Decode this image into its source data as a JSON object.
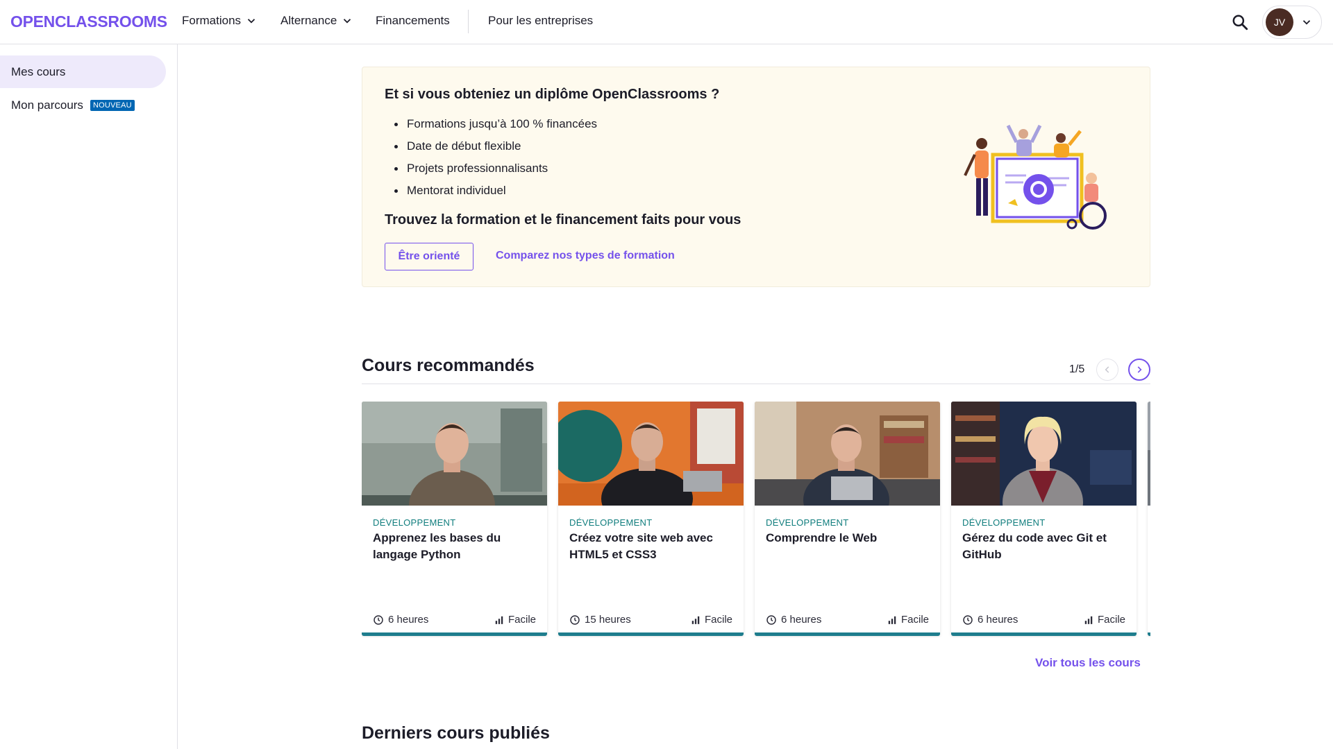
{
  "header": {
    "logo": "OPENCLASSROOMS",
    "nav": [
      {
        "label": "Formations"
      },
      {
        "label": "Alternance"
      },
      {
        "label": "Financements"
      },
      {
        "label": "Pour les entreprises"
      }
    ],
    "user_initials": "JV"
  },
  "sidebar": {
    "items": [
      {
        "label": "Mes cours"
      },
      {
        "label": "Mon parcours",
        "badge": "NOUVEAU"
      }
    ]
  },
  "promo": {
    "title": "Et si vous obteniez un diplôme OpenClassrooms ?",
    "bullets": [
      "Formations jusqu’à 100 % financées",
      "Date de début flexible",
      "Projets professionnalisants",
      "Mentorat individuel"
    ],
    "subtitle": "Trouvez la formation et le financement faits pour vous",
    "primary_button": "Être orienté",
    "secondary_link": "Comparez nos types de formation"
  },
  "recommended": {
    "title": "Cours recommandés",
    "pager": "1/5",
    "courses": [
      {
        "category": "DÉVELOPPEMENT",
        "title": "Apprenez les bases du langage Python",
        "duration": "6 heures",
        "level": "Facile"
      },
      {
        "category": "DÉVELOPPEMENT",
        "title": "Créez votre site web avec HTML5 et CSS3",
        "duration": "15 heures",
        "level": "Facile"
      },
      {
        "category": "DÉVELOPPEMENT",
        "title": "Comprendre le Web",
        "duration": "6 heures",
        "level": "Facile"
      },
      {
        "category": "DÉVELOPPEMENT",
        "title": "Gérez du code avec Git et GitHub",
        "duration": "6 heures",
        "level": "Facile"
      }
    ],
    "see_all": "Voir tous les cours"
  },
  "latest": {
    "title": "Derniers cours publiés"
  },
  "colors": {
    "brand": "#7451eb",
    "category": "#0f7d7d",
    "card_border": "#1e7d8d",
    "promo_bg": "#fefaee"
  },
  "icons": [
    "chevron-down-icon",
    "search-icon",
    "clock-icon",
    "level-bars-icon",
    "chevron-left-icon",
    "chevron-right-icon"
  ]
}
